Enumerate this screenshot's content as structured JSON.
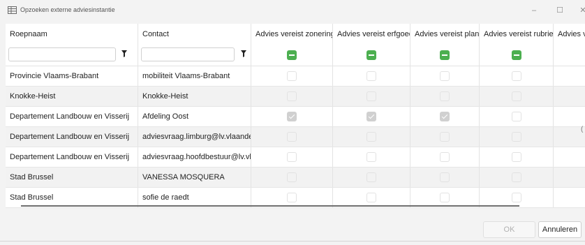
{
  "window": {
    "title": "Opzoeken externe adviesinstantie",
    "icon": "table-icon",
    "controls": {
      "minimize": "–",
      "maximize": "☐",
      "close": "✕"
    }
  },
  "table": {
    "columns": [
      "Roepnaam",
      "Contact",
      "Advies vereist zonering",
      "Advies vereist erfgoed",
      "Advies vereist plan",
      "Advies vereist rubriek",
      "Advies ve"
    ],
    "filters": {
      "roepnaam": "",
      "contact": "",
      "zonering_state": "indeterminate",
      "erfgoed_state": "indeterminate",
      "plan_state": "indeterminate",
      "rubriek_state": "indeterminate",
      "indeterminate_color": "#4caf50"
    },
    "rows": [
      {
        "roepnaam": "Provincie Vlaams-Brabant",
        "contact": "mobiliteit Vlaams-Brabant",
        "zonering": false,
        "erfgoed": false,
        "plan": false,
        "rubriek": false
      },
      {
        "roepnaam": "Knokke-Heist",
        "contact": "Knokke-Heist",
        "zonering": false,
        "erfgoed": false,
        "plan": false,
        "rubriek": false
      },
      {
        "roepnaam": "Departement Landbouw en Visserij",
        "contact": "Afdeling Oost",
        "zonering": true,
        "erfgoed": true,
        "plan": true,
        "rubriek": false
      },
      {
        "roepnaam": "Departement Landbouw en Visserij",
        "contact": "adviesvraag.limburg@lv.vlaandere",
        "zonering": false,
        "erfgoed": false,
        "plan": false,
        "rubriek": false
      },
      {
        "roepnaam": "Departement Landbouw en Visserij",
        "contact": "adviesvraag.hoofdbestuur@lv.vlaa",
        "zonering": false,
        "erfgoed": false,
        "plan": false,
        "rubriek": false
      },
      {
        "roepnaam": "Stad Brussel",
        "contact": "VANESSA MOSQUERA",
        "zonering": false,
        "erfgoed": false,
        "plan": false,
        "rubriek": false
      },
      {
        "roepnaam": "Stad Brussel",
        "contact": "sofie de raedt",
        "zonering": false,
        "erfgoed": false,
        "plan": false,
        "rubriek": false
      }
    ],
    "edge_glyph": "("
  },
  "buttons": {
    "ok": "OK",
    "cancel": "Annuleren"
  }
}
